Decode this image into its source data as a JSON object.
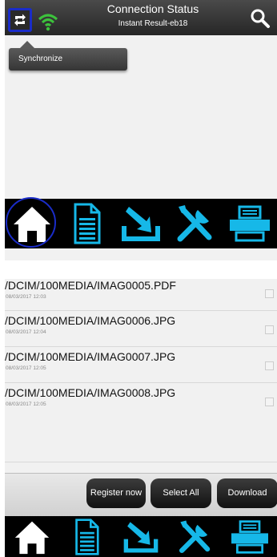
{
  "header": {
    "title": "Connection Status",
    "subtitle": "Instant Result-eb18",
    "sync_icon": "sync-icon",
    "wifi_icon": "wifi-icon",
    "search_icon": "search-icon"
  },
  "tooltip": {
    "label": "Synchronize"
  },
  "nav": {
    "items": [
      {
        "icon": "home-icon"
      },
      {
        "icon": "document-icon"
      },
      {
        "icon": "download-icon"
      },
      {
        "icon": "tools-icon"
      },
      {
        "icon": "printer-icon"
      }
    ]
  },
  "files": [
    {
      "name": "/DCIM/100MEDIA/IMAG0005.PDF",
      "date": "08/03/2017 12:03"
    },
    {
      "name": "/DCIM/100MEDIA/IMAG0006.JPG",
      "date": "08/03/2017 12:04"
    },
    {
      "name": "/DCIM/100MEDIA/IMAG0007.JPG",
      "date": "08/03/2017 12:05"
    },
    {
      "name": "/DCIM/100MEDIA/IMAG0008.JPG",
      "date": "08/03/2017 12:05"
    }
  ],
  "actions": {
    "register": "Register now",
    "select_all": "Select All",
    "download": "Download"
  },
  "colors": {
    "accent_blue": "#1a2cc8",
    "icon_cyan": "#16b8e8",
    "wifi_green": "#3cc23c"
  }
}
